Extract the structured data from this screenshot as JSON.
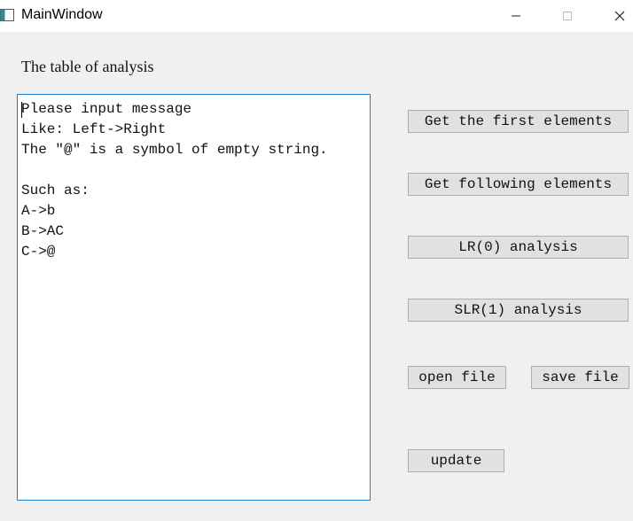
{
  "window": {
    "title": "MainWindow",
    "minimize_glyph": "—",
    "maximize_glyph": "☐",
    "close_glyph": "✕"
  },
  "main": {
    "heading": "The table of analysis",
    "input_lines": [
      "Please input message",
      "Like: Left->Right",
      "The \"@\" is a symbol of empty string.",
      "",
      "Such as:",
      "A->b",
      "B->AC",
      "C->@"
    ]
  },
  "buttons": {
    "first": "Get the first elements",
    "follow": "Get following elements",
    "lr0": "LR(0) analysis",
    "slr1": "SLR(1) analysis",
    "open": "open file",
    "save": "save file",
    "update": "update"
  },
  "colors": {
    "background": "#f0f0f0",
    "titlebar": "#ffffff",
    "textarea_border": "#1c7fd4",
    "button_bg": "#e1e1e1",
    "button_border": "#adadad"
  }
}
